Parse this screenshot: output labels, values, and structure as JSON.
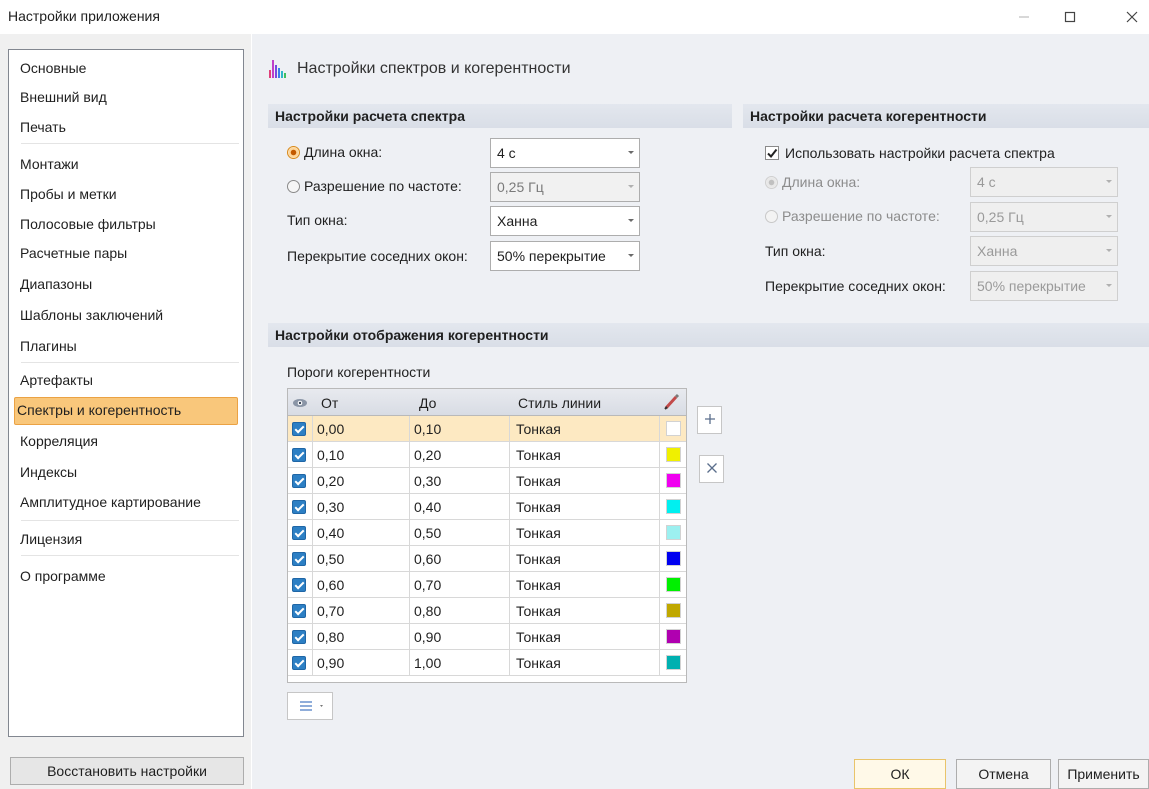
{
  "window": {
    "title": "Настройки приложения",
    "minimize_icon": "minimize-icon",
    "maximize_icon": "maximize-icon",
    "close_icon": "close-icon"
  },
  "sidebar": {
    "items": [
      {
        "label": "Основные"
      },
      {
        "label": "Внешний вид"
      },
      {
        "label": "Печать"
      },
      {
        "label": "Монтажи"
      },
      {
        "label": "Пробы и метки"
      },
      {
        "label": "Полосовые фильтры"
      },
      {
        "label": "Расчетные пары"
      },
      {
        "label": "Диапазоны"
      },
      {
        "label": "Шаблоны заключений"
      },
      {
        "label": "Плагины"
      },
      {
        "label": "Артефакты"
      },
      {
        "label": "Спектры и когерентность"
      },
      {
        "label": "Корреляция"
      },
      {
        "label": "Индексы"
      },
      {
        "label": "Амплитудное картирование"
      },
      {
        "label": "Лицензия"
      },
      {
        "label": "О программе"
      }
    ],
    "selected_index": 11,
    "restore_button": "Восстановить настройки"
  },
  "page": {
    "title": "Настройки спектров и когерентности",
    "icon": "spectrum-icon"
  },
  "spectrum": {
    "header": "Настройки расчета спектра",
    "window_length_label": "Длина окна:",
    "window_length_value": "4 с",
    "window_length_selected": true,
    "freq_res_label": "Разрешение по частоте:",
    "freq_res_value": "0,25 Гц",
    "window_type_label": "Тип окна:",
    "window_type_value": "Ханна",
    "overlap_label": "Перекрытие соседних окон:",
    "overlap_value": "50% перекрытие"
  },
  "coherence_calc": {
    "header": "Настройки расчета когерентности",
    "use_spectrum_label": "Использовать настройки расчета спектра",
    "use_spectrum_checked": true,
    "window_length_label": "Длина окна:",
    "window_length_value": "4 с",
    "freq_res_label": "Разрешение по частоте:",
    "freq_res_value": "0,25 Гц",
    "window_type_label": "Тип окна:",
    "window_type_value": "Ханна",
    "overlap_label": "Перекрытие соседних окон:",
    "overlap_value": "50% перекрытие"
  },
  "coherence_display": {
    "header": "Настройки отображения когерентности",
    "thresholds_label": "Пороги когерентности",
    "columns": {
      "from": "От",
      "to": "До",
      "style": "Стиль линии"
    },
    "eye_icon": "eye-icon",
    "color_icon": "color-pencil-icon",
    "rows": [
      {
        "from": "0,00",
        "to": "0,10",
        "style": "Тонкая",
        "color": "#ffffff"
      },
      {
        "from": "0,10",
        "to": "0,20",
        "style": "Тонкая",
        "color": "#f0f000"
      },
      {
        "from": "0,20",
        "to": "0,30",
        "style": "Тонкая",
        "color": "#f000f0"
      },
      {
        "from": "0,30",
        "to": "0,40",
        "style": "Тонкая",
        "color": "#00f0f0"
      },
      {
        "from": "0,40",
        "to": "0,50",
        "style": "Тонкая",
        "color": "#9cf0f0"
      },
      {
        "from": "0,50",
        "to": "0,60",
        "style": "Тонкая",
        "color": "#0000f0"
      },
      {
        "from": "0,60",
        "to": "0,70",
        "style": "Тонкая",
        "color": "#00f000"
      },
      {
        "from": "0,70",
        "to": "0,80",
        "style": "Тонкая",
        "color": "#c0a800"
      },
      {
        "from": "0,80",
        "to": "0,90",
        "style": "Тонкая",
        "color": "#b000b0"
      },
      {
        "from": "0,90",
        "to": "1,00",
        "style": "Тонкая",
        "color": "#00b0b0"
      }
    ],
    "selected_row": 0,
    "add_icon": "plus-icon",
    "remove_icon": "x-icon",
    "menu_icon": "list-menu-icon"
  },
  "footer": {
    "ok": "ОК",
    "cancel": "Отмена",
    "apply": "Применить"
  },
  "colors": {
    "selection": "#f9c77b",
    "row_highlight": "#fde9c2",
    "section_band": "#dfe3ea"
  }
}
